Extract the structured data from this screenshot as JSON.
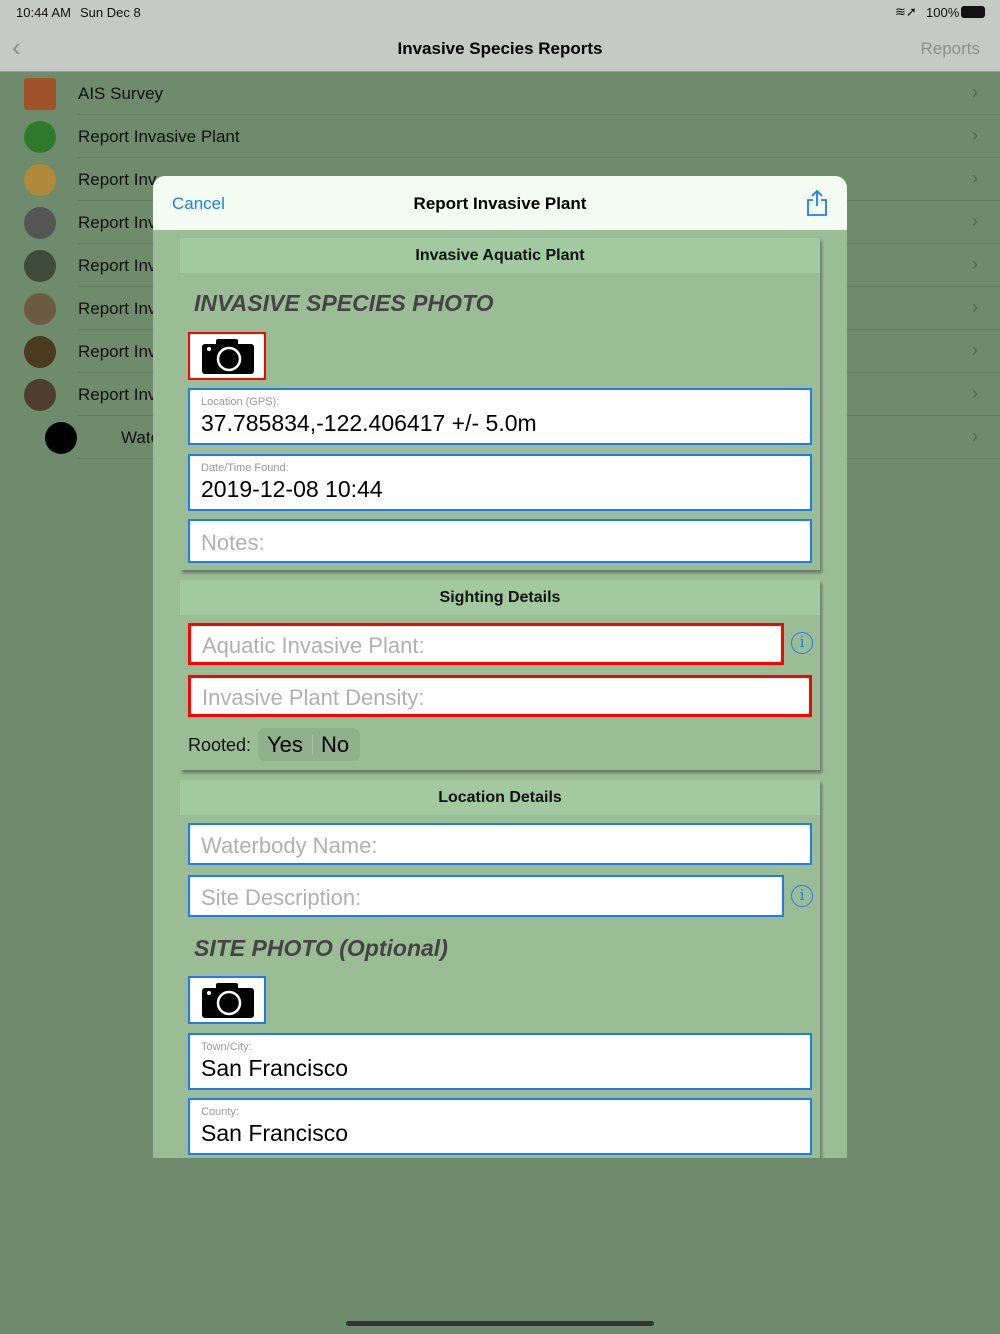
{
  "status_bar": {
    "time": "10:44 AM",
    "date": "Sun Dec 8",
    "battery": "100%"
  },
  "nav": {
    "title": "Invasive Species Reports",
    "right": "Reports"
  },
  "list": [
    {
      "label": "AIS Survey",
      "icon": "clipboard-icon"
    },
    {
      "label": "Report Invasive Plant",
      "icon": "plant-icon"
    },
    {
      "label": "Report Inv",
      "icon": "mollusk-icon"
    },
    {
      "label": "Report Inv",
      "icon": "crayfish-icon"
    },
    {
      "label": "Report Inv",
      "icon": "fish-icon"
    },
    {
      "label": "Report Inv",
      "icon": "urchin-icon"
    },
    {
      "label": "Report Inv",
      "icon": "turtle-icon"
    },
    {
      "label": "Report Inv",
      "icon": "rodent-icon"
    },
    {
      "label": "Wate",
      "icon": "secchi-disk-icon"
    }
  ],
  "modal": {
    "cancel": "Cancel",
    "title": "Report Invasive Plant",
    "card1": {
      "header": "Invasive Aquatic Plant",
      "photo_title": "INVASIVE SPECIES PHOTO",
      "location_label": "Location (GPS):",
      "location_value": "37.785834,-122.406417 +/- 5.0m",
      "date_label": "Date/Time Found:",
      "date_value": "2019-12-08 10:44",
      "notes_placeholder": "Notes:"
    },
    "card2": {
      "header": "Sighting Details",
      "plant_placeholder": "Aquatic Invasive Plant:",
      "density_placeholder": "Invasive Plant Density:",
      "rooted_label": "Rooted:",
      "yes": "Yes",
      "no": "No"
    },
    "card3": {
      "header": "Location Details",
      "waterbody_placeholder": "Waterbody Name:",
      "site_placeholder": "Site Description:",
      "photo_title": "SITE PHOTO (Optional)",
      "town_label": "Town/City:",
      "town_value": "San Francisco",
      "county_label": "County:",
      "county_value": "San Francisco"
    }
  }
}
